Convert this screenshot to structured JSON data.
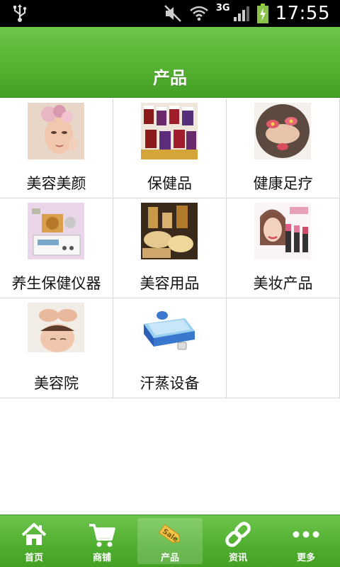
{
  "status_bar": {
    "time": "17:55",
    "network": "3G",
    "icons": [
      "usb-icon",
      "mute-icon",
      "wifi-icon",
      "signal-icon",
      "battery-charging-icon"
    ]
  },
  "header": {
    "title": "产品"
  },
  "categories": [
    {
      "label": "美容美颜",
      "icon": "beauty-face-image"
    },
    {
      "label": "保健品",
      "icon": "supplement-bottles-image"
    },
    {
      "label": "健康足疗",
      "icon": "foot-spa-image"
    },
    {
      "label": "养生保健仪器",
      "icon": "health-device-image"
    },
    {
      "label": "美容用品",
      "icon": "spa-supplies-image"
    },
    {
      "label": "美妆产品",
      "icon": "cosmetics-image"
    },
    {
      "label": "美容院",
      "icon": "beauty-salon-image"
    },
    {
      "label": "汗蒸设备",
      "icon": "sauna-tub-image"
    }
  ],
  "bottom_nav": {
    "items": [
      {
        "label": "首页",
        "icon": "home-icon"
      },
      {
        "label": "商铺",
        "icon": "cart-icon"
      },
      {
        "label": "产品",
        "icon": "sale-tag-icon",
        "active": true
      },
      {
        "label": "资讯",
        "icon": "link-icon"
      },
      {
        "label": "更多",
        "icon": "more-icon"
      }
    ]
  },
  "colors": {
    "header_green": "#55b232",
    "nav_green": "#4fae2f",
    "grid_border": "#d8d8d8"
  }
}
